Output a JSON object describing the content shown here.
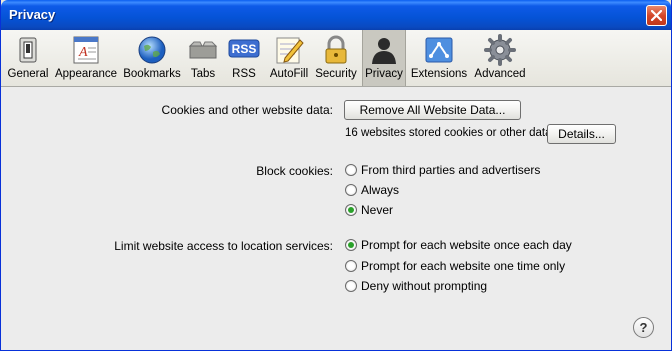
{
  "window": {
    "title": "Privacy"
  },
  "toolbar": {
    "items": [
      {
        "label": "General",
        "icon": "switch-icon"
      },
      {
        "label": "Appearance",
        "icon": "appearance-icon"
      },
      {
        "label": "Bookmarks",
        "icon": "globe-icon"
      },
      {
        "label": "Tabs",
        "icon": "tabs-icon"
      },
      {
        "label": "RSS",
        "icon": "rss-icon",
        "badge": "RSS"
      },
      {
        "label": "AutoFill",
        "icon": "autofill-pencil-icon"
      },
      {
        "label": "Security",
        "icon": "lock-icon"
      },
      {
        "label": "Privacy",
        "icon": "person-icon"
      },
      {
        "label": "Extensions",
        "icon": "extensions-icon"
      },
      {
        "label": "Advanced",
        "icon": "gear-icon"
      }
    ],
    "selected": "Privacy"
  },
  "cookies": {
    "label": "Cookies and other website data:",
    "remove_button": "Remove All Website Data...",
    "stored_text": "16 websites stored cookies or other data",
    "details_button": "Details..."
  },
  "block_cookies": {
    "label": "Block cookies:",
    "options": [
      "From third parties and advertisers",
      "Always",
      "Never"
    ],
    "selected": "Never"
  },
  "location": {
    "label": "Limit website access to location services:",
    "options": [
      "Prompt for each website once each day",
      "Prompt for each website one time only",
      "Deny without prompting"
    ],
    "selected": "Prompt for each website once each day"
  },
  "help": {
    "label": "?"
  },
  "colors": {
    "title_bar": "#0553d6",
    "radio_selected": "#2aa12a",
    "close_button": "#d4482a"
  }
}
